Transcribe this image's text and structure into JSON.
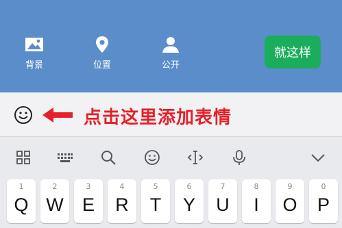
{
  "actions": {
    "background_label": "背景",
    "location_label": "位置",
    "public_label": "公开",
    "done_label": "就这样"
  },
  "input": {
    "hint": "点击这里添加表情"
  },
  "colors": {
    "panel": "#5b8dca",
    "done": "#1aad5c",
    "hint": "#e5202a"
  },
  "toolbar_icons": [
    "grid-icon",
    "keyboard-icon",
    "search-icon",
    "emoji-icon",
    "cursor-icon",
    "mic-icon",
    "collapse-icon"
  ],
  "keys": [
    {
      "num": "1",
      "ch": "Q"
    },
    {
      "num": "2",
      "ch": "W"
    },
    {
      "num": "3",
      "ch": "E"
    },
    {
      "num": "4",
      "ch": "R"
    },
    {
      "num": "5",
      "ch": "T"
    },
    {
      "num": "6",
      "ch": "Y"
    },
    {
      "num": "7",
      "ch": "U"
    },
    {
      "num": "8",
      "ch": "I"
    },
    {
      "num": "9",
      "ch": "O"
    },
    {
      "num": "0",
      "ch": "P"
    }
  ]
}
